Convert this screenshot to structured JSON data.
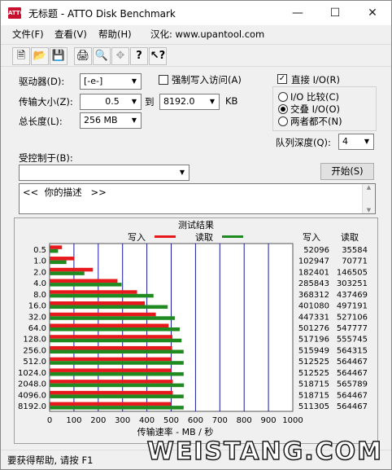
{
  "window": {
    "title": "无标题 - ATTO Disk Benchmark",
    "app_icon": "ATTO"
  },
  "menu": [
    {
      "label": "文件(F)"
    },
    {
      "label": "查看(V)"
    },
    {
      "label": "帮助(H)"
    },
    {
      "label": "汉化: www.upantool.com"
    }
  ],
  "toolbar": [
    "new-file-icon",
    "open-folder-icon",
    "save-icon",
    "print-icon",
    "print-preview-icon",
    "move-icon",
    "help-icon",
    "context-help-icon"
  ],
  "settings": {
    "drive_label": "驱动器(D):",
    "drive_value": "[-e-]",
    "force_write_label": "强制写入访问(A)",
    "force_write_checked": false,
    "transfer_size_label": "传输大小(Z):",
    "transfer_from": "0.5",
    "to_label": "到",
    "transfer_to": "8192.0",
    "unit_label": "KB",
    "total_length_label": "总长度(L):",
    "total_length_value": "256 MB",
    "direct_io_label": "直接 I/O(R)",
    "direct_io_checked": true,
    "io_options": [
      {
        "label": "I/O 比较(C)",
        "selected": false
      },
      {
        "label": "交叠 I/O(O)",
        "selected": true
      },
      {
        "label": "两者都不(N)",
        "selected": false
      }
    ],
    "queue_depth_label": "队列深度(Q):",
    "queue_depth_value": "4",
    "controlled_by_label": "受控制于(B):",
    "controlled_by_value": "",
    "start_button": "开始(S)",
    "description_text": "<<  你的描述   >>"
  },
  "results": {
    "title": "测试结果",
    "legend_write": "写入",
    "legend_read": "读取",
    "col_write": "写入",
    "col_read": "读取",
    "xlabel": "传输速率 - MB / 秒",
    "colors": {
      "write": "#e8191c",
      "read": "#1f8a1f",
      "plot_bg": "#ffffff",
      "grid": "#1a1aa0"
    }
  },
  "chart_data": {
    "type": "bar",
    "orientation": "horizontal",
    "title": "测试结果",
    "xlabel": "传输速率 - MB / 秒",
    "xlim": [
      0,
      1000
    ],
    "xticks": [
      0,
      100,
      200,
      300,
      400,
      500,
      600,
      700,
      800,
      900,
      1000
    ],
    "categories": [
      "0.5",
      "1.0",
      "2.0",
      "4.0",
      "8.0",
      "16.0",
      "32.0",
      "64.0",
      "128.0",
      "256.0",
      "512.0",
      "1024.0",
      "2048.0",
      "4096.0",
      "8192.0"
    ],
    "series": [
      {
        "name": "写入",
        "values": [
          52096,
          102947,
          182401,
          285843,
          368312,
          401080,
          447331,
          501276,
          517196,
          515949,
          512525,
          512525,
          518715,
          518715,
          511305
        ]
      },
      {
        "name": "读取",
        "values": [
          35584,
          70771,
          146505,
          303251,
          437469,
          497191,
          527106,
          547777,
          555745,
          564315,
          564467,
          564467,
          565789,
          564467,
          564467
        ]
      }
    ]
  },
  "status": {
    "text": "要获得帮助, 请按 F1"
  },
  "watermark": "WEISTANG.COM"
}
